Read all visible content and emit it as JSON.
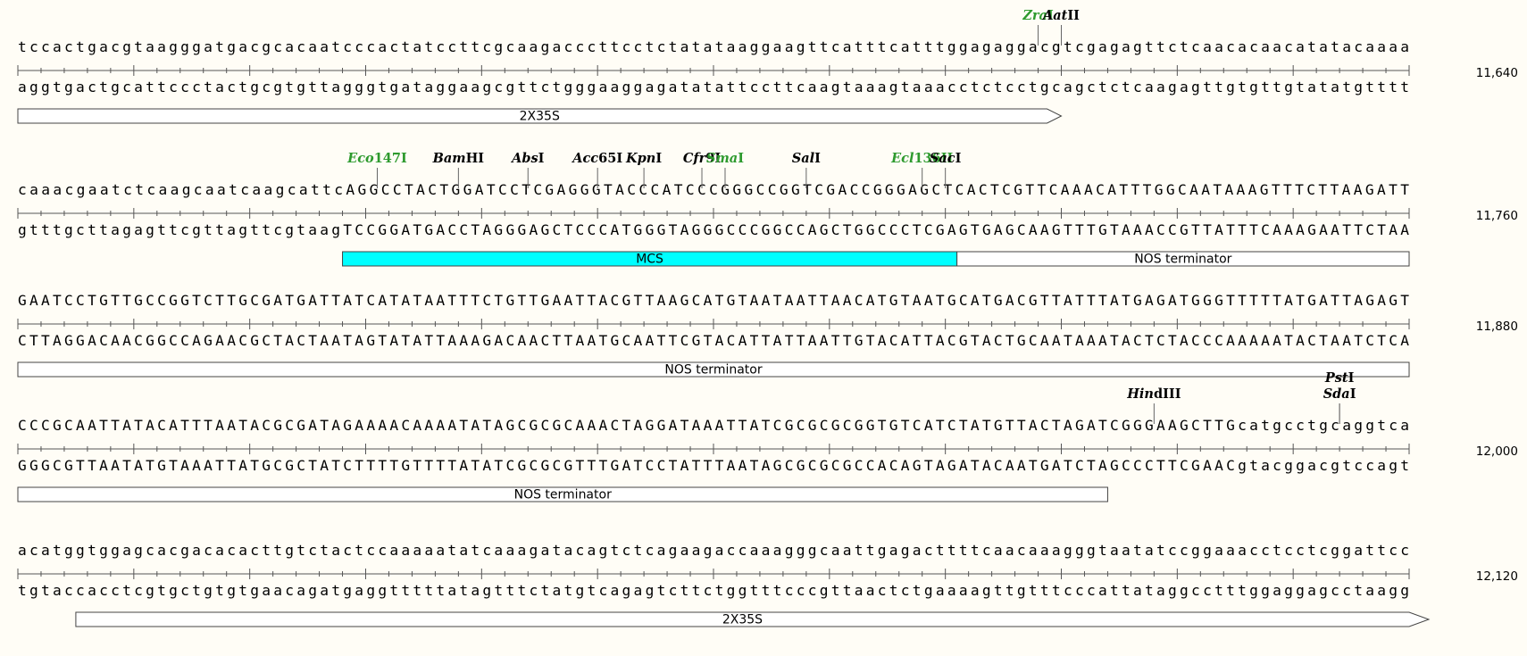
{
  "colors": {
    "background": "#fffdf6",
    "enzyme_unique": "#000000",
    "enzyme_blunt": "#2e9a2e",
    "feature_mcs": "#00ffff",
    "feature_default": "#ffffff"
  },
  "rows": [
    {
      "id": "row1",
      "position": "11,640",
      "top": "tccactgacgtaagggatgacgcacaatcccactatccttcgcaagacccttcctctatataaggaagttcatttcatttggagaggacgtcgagagttctcaacacaacatatacaaaa",
      "bottom": "aggtgactgcattccctactgcgtgttagggtgataggaagcgttctgggaaggagatatattccttcaagtaaagtaaacctctcctgcagctctcaagagttgtgttgtatatgtttt",
      "enzymes": [
        {
          "name": "ZraI",
          "italic": "Zra",
          "roman": "I",
          "cut": 88,
          "color": "green",
          "level": 0
        },
        {
          "name": "AatII",
          "italic": "Aat",
          "roman": "II",
          "cut": 90,
          "color": "black",
          "level": 0
        }
      ],
      "features": [
        {
          "label": "2X35S",
          "start": 0,
          "end": 90,
          "kind": "arrow-right",
          "fill": "default"
        }
      ]
    },
    {
      "id": "row2",
      "position": "11,760",
      "top": "caaacgaatctcaagcaatcaagcattcAGGCCTACTGGATCCTCGAGGGTACCCATCCCGGGCCGGTCGACCGGGAGCTCACTCGTTCAAACATTTGGCAATAAAGTTTCTTAAGATT",
      "bottom": "gtttgcttagagttcgttagttcgtaagTCCGGATGACCTAGGGAGCTCCCATGGGTAGGGCCCGGCCAGCTGGCCCTCGAGTGAGCAAGTTTGTAAACCGTTATTTCAAAGAATTCTAA",
      "enzymes": [
        {
          "name": "Eco147I",
          "italic": "Eco",
          "roman": "147I",
          "cut": 31,
          "color": "green",
          "level": 0
        },
        {
          "name": "BamHI",
          "italic": "Bam",
          "roman": "HI",
          "cut": 38,
          "color": "black",
          "level": 0
        },
        {
          "name": "AbsI",
          "italic": "Abs",
          "roman": "I",
          "cut": 44,
          "color": "black",
          "level": 0
        },
        {
          "name": "Acc65I",
          "italic": "Acc",
          "roman": "65I",
          "cut": 50,
          "color": "black",
          "level": 0
        },
        {
          "name": "KpnI",
          "italic": "Kpn",
          "roman": "I",
          "cut": 54,
          "color": "black",
          "level": 0
        },
        {
          "name": "Cfr9I",
          "italic": "Cfr",
          "roman": "9I",
          "cut": 59,
          "color": "black",
          "level": 0
        },
        {
          "name": "SmaI",
          "italic": "Sma",
          "roman": "I",
          "cut": 61,
          "color": "green",
          "level": 0
        },
        {
          "name": "SalI",
          "italic": "Sal",
          "roman": "I",
          "cut": 68,
          "color": "black",
          "level": 0
        },
        {
          "name": "Ecl136II",
          "italic": "Ecl",
          "roman": "136II",
          "cut": 78,
          "color": "green",
          "level": 0
        },
        {
          "name": "SacI",
          "italic": "Sac",
          "roman": "I",
          "cut": 80,
          "color": "black",
          "level": 0
        }
      ],
      "features": [
        {
          "label": "MCS",
          "start": 28,
          "end": 81,
          "kind": "box",
          "fill": "mcs"
        },
        {
          "label": "NOS terminator",
          "start": 81,
          "end": 120,
          "kind": "box",
          "fill": "default"
        }
      ]
    },
    {
      "id": "row3",
      "position": "11,880",
      "top": "GAATCCTGTTGCCGGTCTTGCGATGATTATCATATAATTTCTGTTGAATTACGTTAAGCATGTAATAATTAACATGTAATGCATGACGTTATTTATGAGATGGGTTTTTATGATTAGAGT",
      "bottom": "CTTAGGACAACGGCCAGAACGCTACTAATAGTATATTAAAGACAACTTAATGCAATTCGTACATTATTAATTGTACATTACGTACTGCAATAAATACTCTACCCAAAAATACTAATCTCA",
      "enzymes": [],
      "features": [
        {
          "label": "NOS terminator",
          "start": 0,
          "end": 120,
          "kind": "box",
          "fill": "default"
        }
      ]
    },
    {
      "id": "row4",
      "position": "12,000",
      "top": "CCCGCAATTATACATTTAATACGCGATAGAAAACAAAATATAGCGCGCAAACTAGGATAAATTATCGCGCGCGGTGTCATCTATGTTACTAGATCGGGAAGCTTGcatgcctgcaggtca",
      "bottom": "GGGCGTTAATATGTAAATTATGCGCTATCTTTTGTTTTATATCGCGCGTTTGATCCTATTTAATAGCGCGCGCCACAGTAGATACAATGATCTAGCCCTTCGAACgtacggacgtccagt",
      "enzymes": [
        {
          "name": "HindIII",
          "italic": "Hin",
          "roman": "dIII",
          "cut": 98,
          "color": "black",
          "level": 0
        },
        {
          "name": "PstI",
          "italic": "Pst",
          "roman": "I",
          "cut": 114,
          "color": "black",
          "level": 1
        },
        {
          "name": "SdaI",
          "italic": "Sda",
          "roman": "I",
          "cut": 114,
          "color": "black",
          "level": 0
        }
      ],
      "features": [
        {
          "label": "NOS terminator",
          "start": 0,
          "end": 94,
          "kind": "box",
          "fill": "default"
        }
      ]
    },
    {
      "id": "row5",
      "position": "12,120",
      "top": "acatggtggagcacgacacacttgtctactccaaaaatatcaaagatacagtctcagaagaccaaagggcaattgagacttttcaacaaagggtaatatccggaaacctcctcggattcc",
      "bottom": "tgtaccacctcgtgctgtgtgaacagatgaggtttttatagtttctatgtcagagtcttctggtttcccgttaactctgaaaagttgtttcccattataggcctttggaggagcctaagg",
      "enzymes": [],
      "features": [
        {
          "label": "2X35S",
          "start": 5,
          "end": 120,
          "kind": "arrow-right-open",
          "fill": "default"
        }
      ]
    }
  ]
}
